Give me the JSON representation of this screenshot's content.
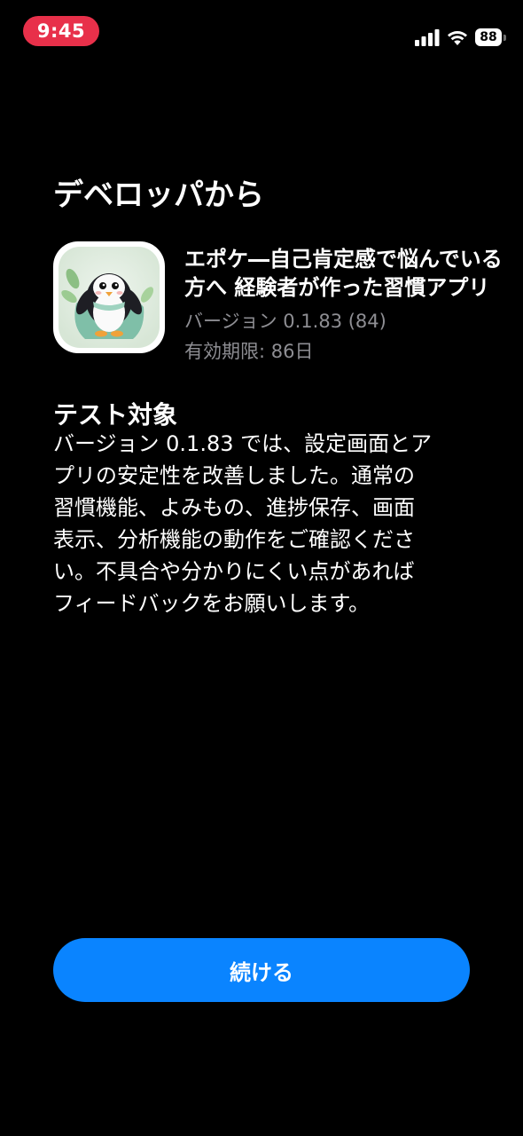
{
  "status_bar": {
    "time": "9:45",
    "battery_level": "88",
    "time_pill_color": "#e8304a",
    "icons": [
      "cellular-signal-icon",
      "wifi-icon",
      "battery-icon"
    ]
  },
  "header": {
    "title": "デベロッパから"
  },
  "app": {
    "icon": "penguin-app-icon",
    "name_lines": [
      "エポケ―自己肯定感で悩んでいる",
      "方へ 経験者が作った習慣アプリ"
    ],
    "version": "バージョン 0.1.83 (84)",
    "expiry": "有効期限: 86日"
  },
  "what_to_test": {
    "title": "テスト対象",
    "body_lines": [
      "バージョン 0.1.83 では、設定画面とア",
      "プリの安定性を改善しました。通常の",
      "習慣機能、よみもの、進捗保存、画面",
      "表示、分析機能の動作をご確認くださ",
      "い。不具合や分かりにくい点があれば",
      "フィードバックをお願いします。"
    ]
  },
  "actions": {
    "continue_label": "続ける",
    "accent_color": "#0a84ff"
  }
}
